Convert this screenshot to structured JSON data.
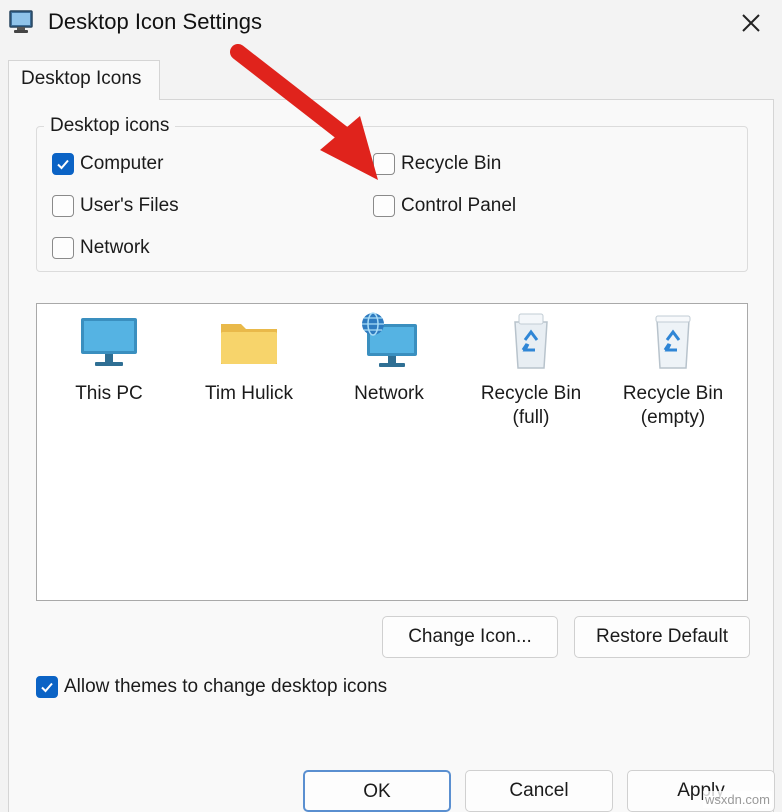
{
  "window": {
    "title": "Desktop Icon Settings",
    "close_glyph": "✕"
  },
  "tab": {
    "label": "Desktop Icons"
  },
  "desktop_icons_group": {
    "legend": "Desktop icons",
    "checkboxes": [
      {
        "label": "Computer",
        "checked": true
      },
      {
        "label": "Recycle Bin",
        "checked": false
      },
      {
        "label": "User's Files",
        "checked": false
      },
      {
        "label": "Control Panel",
        "checked": false
      },
      {
        "label": "Network",
        "checked": false
      }
    ]
  },
  "icon_list": [
    {
      "label": "This PC",
      "icon": "monitor-icon"
    },
    {
      "label": "Tim Hulick",
      "icon": "folder-icon"
    },
    {
      "label": "Network",
      "icon": "network-icon"
    },
    {
      "label_line1": "Recycle Bin",
      "label_line2": "(full)",
      "icon": "recycle-bin-full-icon"
    },
    {
      "label_line1": "Recycle Bin",
      "label_line2": "(empty)",
      "icon": "recycle-bin-empty-icon"
    }
  ],
  "buttons": {
    "change_icon": "Change Icon...",
    "restore_default": "Restore Default",
    "ok": "OK",
    "cancel": "Cancel",
    "apply": "Apply"
  },
  "allow_themes": {
    "label": "Allow themes to change desktop icons",
    "checked": true
  },
  "watermark": "wsxdn.com",
  "colors": {
    "accent": "#0b63c5",
    "annotation_arrow": "#e0231c"
  }
}
